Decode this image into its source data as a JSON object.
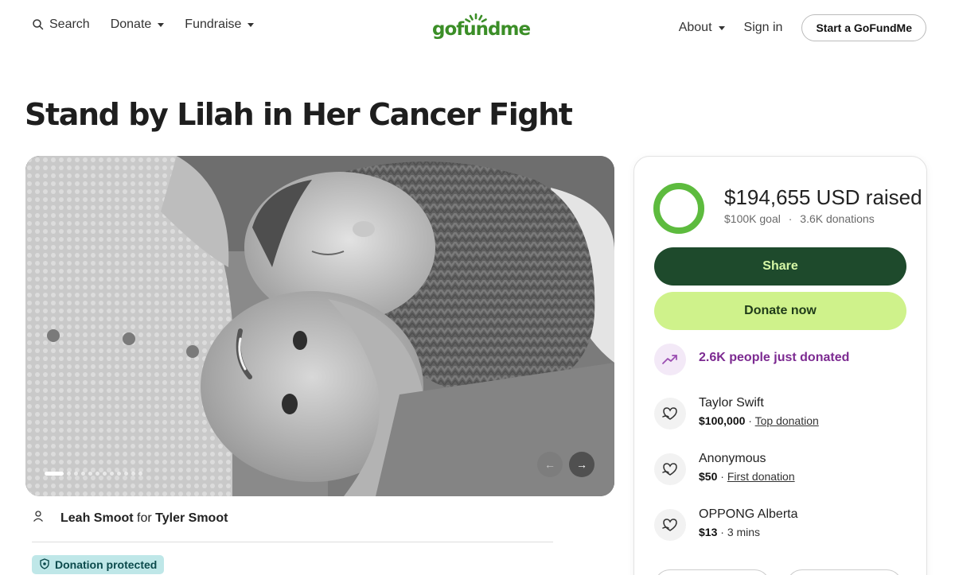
{
  "header": {
    "search_label": "Search",
    "donate_label": "Donate",
    "fundraise_label": "Fundraise",
    "logo_text": "gofundme",
    "about_label": "About",
    "signin_label": "Sign in",
    "start_label": "Start a GoFundMe"
  },
  "campaign": {
    "title": "Stand by Lilah in Her Cancer Fight",
    "organizer": "Leah Smoot",
    "for_word": "for",
    "beneficiary": "Tyler Smoot",
    "protected_label": "Donation protected",
    "slide_count": 12,
    "active_slide": 1
  },
  "progress": {
    "raised": "$194,655 USD raised",
    "goal": "$100K goal",
    "separator": "·",
    "donations": "3.6K donations",
    "fraction": 1.0
  },
  "actions": {
    "share": "Share",
    "donate_now": "Donate now"
  },
  "trend": {
    "text": "2.6K people just donated"
  },
  "donors": [
    {
      "name": "Taylor Swift",
      "amount": "$100,000",
      "sep": " · ",
      "note": "Top donation"
    },
    {
      "name": "Anonymous",
      "amount": "$50",
      "sep": " · ",
      "note": "First donation"
    },
    {
      "name": "OPPONG Alberta",
      "amount": "$13",
      "sep": " · ",
      "note": "3 mins"
    }
  ],
  "colors": {
    "accent_green": "#3b8e27",
    "share_bg": "#1e4a2c",
    "donate_bg": "#cff28b",
    "trend_purple": "#7c2a91",
    "protected_bg": "#bfe7e8"
  }
}
